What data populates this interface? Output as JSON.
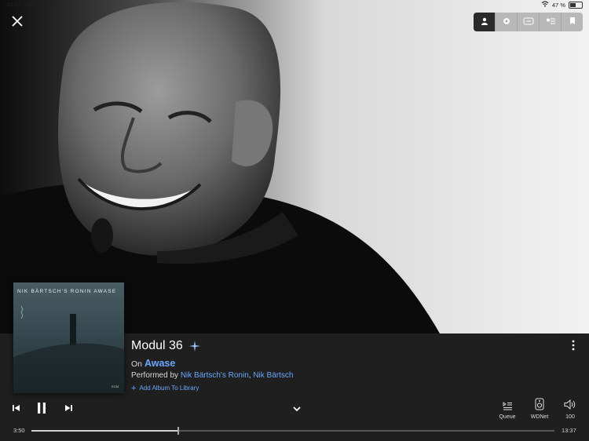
{
  "status_bar": {
    "time": "18:47",
    "date": "søn. 22. des.",
    "battery_percent": "47 %",
    "battery_level": 0.47
  },
  "header": {
    "close_icon": "close-icon",
    "view_modes": [
      {
        "name": "artist-view",
        "icon": "person-icon",
        "active": true
      },
      {
        "name": "playing-view",
        "icon": "record-icon",
        "active": false
      },
      {
        "name": "lyrics-view",
        "icon": "lyrics-icon",
        "active": false
      },
      {
        "name": "credits-view",
        "icon": "credits-icon",
        "active": false
      },
      {
        "name": "info-view",
        "icon": "info-icon",
        "active": false
      }
    ]
  },
  "album_cover": {
    "title": "NIK BÄRTSCH'S RONIN  AWASE",
    "label": "ECM"
  },
  "track": {
    "title": "Modul 36",
    "on_prefix": "On",
    "album": "Awase",
    "performed_prefix": "Performed by",
    "performers": [
      "Nik Bärtsch's Ronin",
      "Nik Bärtsch"
    ],
    "performer_separator": ", ",
    "add_to_library": "Add Album To Library"
  },
  "controls": {
    "queue_label": "Queue",
    "device_label": "WDNet",
    "volume_label": "100"
  },
  "progress": {
    "elapsed": "3:50",
    "total": "13:37",
    "fraction": 0.2815
  },
  "colors": {
    "accent": "#6aa7ff",
    "panel": "#1f1f1f"
  }
}
